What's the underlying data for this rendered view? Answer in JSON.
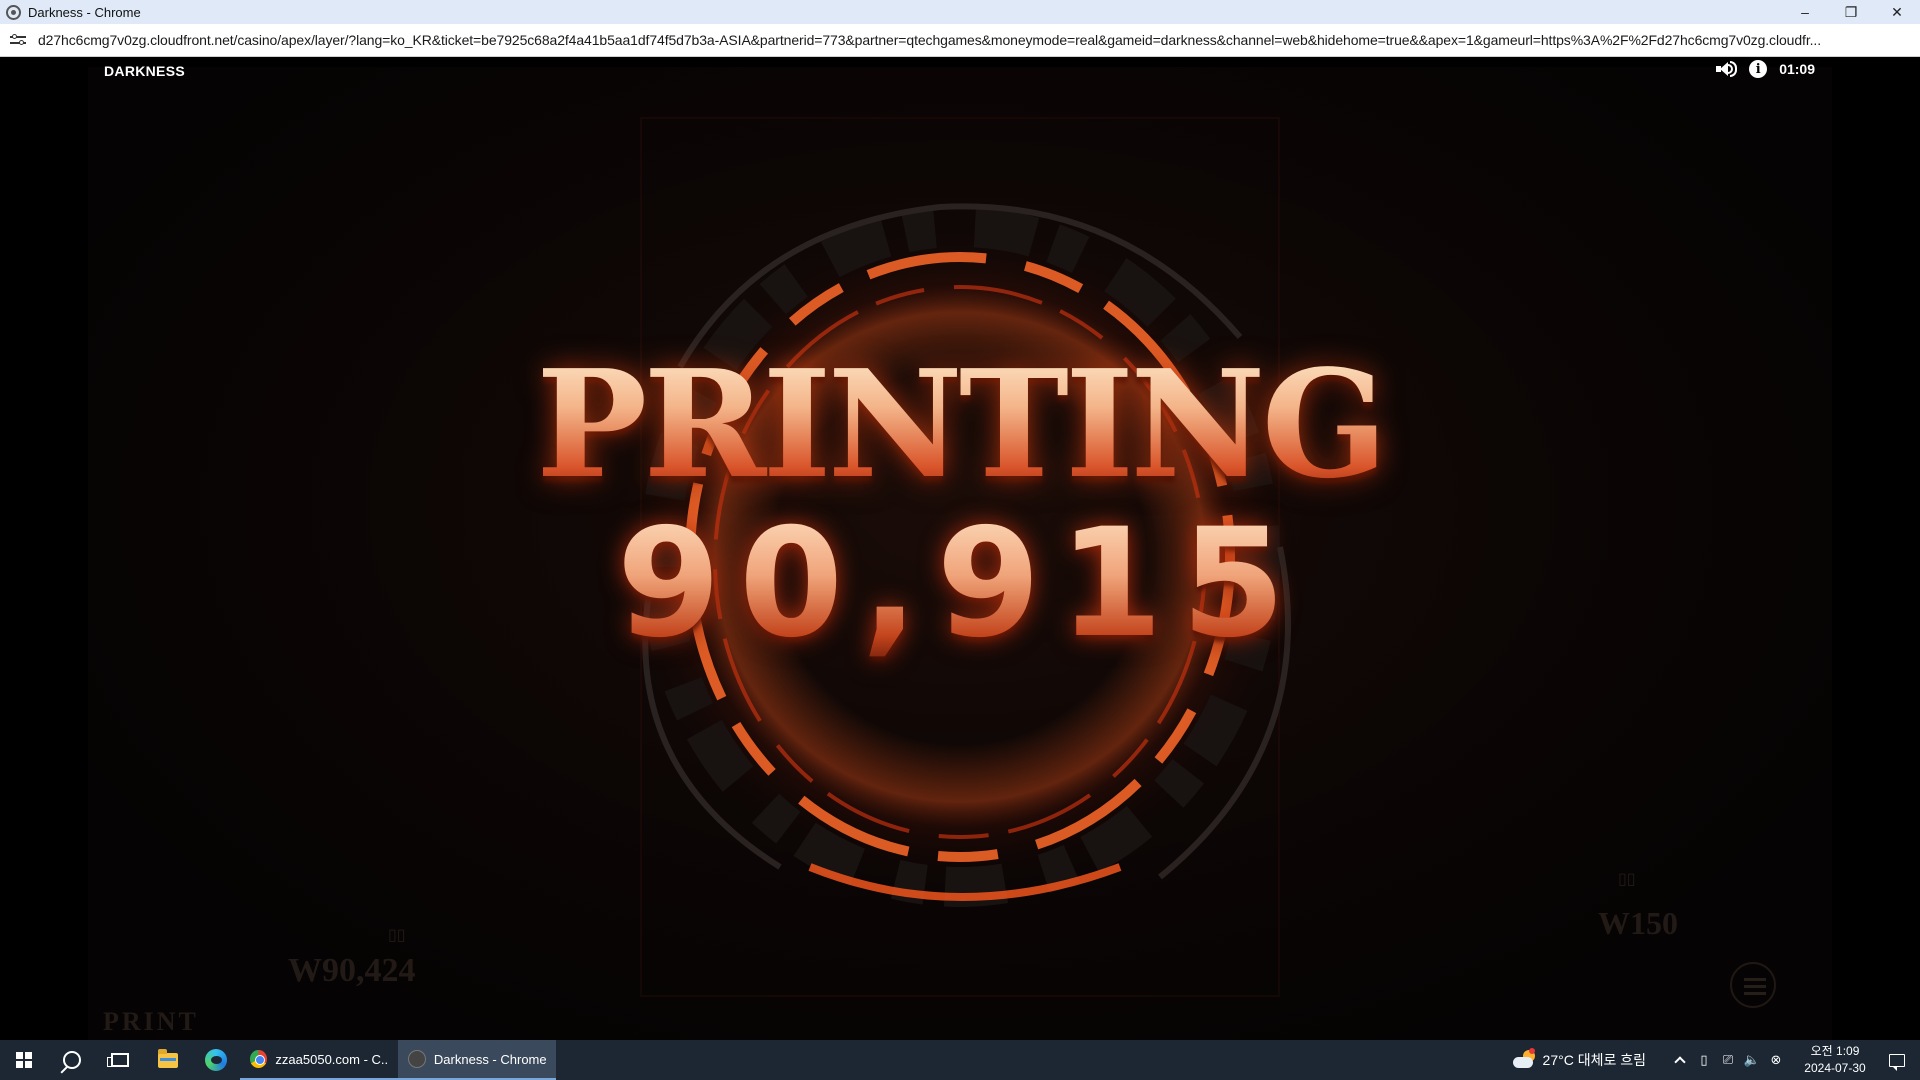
{
  "window": {
    "title": "Darkness - Chrome",
    "controls": {
      "minimize": "–",
      "restore": "❐",
      "close": "✕"
    }
  },
  "address": {
    "url": "d27hc6cmg7v0zg.cloudfront.net/casino/apex/layer/?lang=ko_KR&ticket=be7925c68a2f4a41b5aa1df74f5d7b3a-ASIA&partnerid=773&partner=qtechgames&moneymode=real&gameid=darkness&channel=web&hidehome=true&&apex=1&gameurl=https%3A%2F%2Fd27hc6cmg7v0zg.cloudfr..."
  },
  "game": {
    "title": "DARKNESS",
    "clock": "01:09",
    "icons": {
      "sound": "speaker-icon",
      "info": "info-icon"
    },
    "banner_text": "PRINTING",
    "banner_value": "90,915",
    "background": {
      "left_amount": "W90,424",
      "print_label": "PRINT",
      "right_amount": "W150"
    }
  },
  "taskbar": {
    "apps": [
      {
        "label": "zzaa5050.com - C...",
        "icon": "chrome-icon"
      },
      {
        "label": "Darkness - Chrome",
        "icon": "darkness-icon"
      }
    ],
    "weather": "27°C  대체로 흐림",
    "clock_time": "오전 1:09",
    "clock_date": "2024-07-30"
  },
  "colors": {
    "titlebar": "#dfe9f8",
    "taskbar": "#1c2733",
    "glow": "#ff5a1e"
  }
}
